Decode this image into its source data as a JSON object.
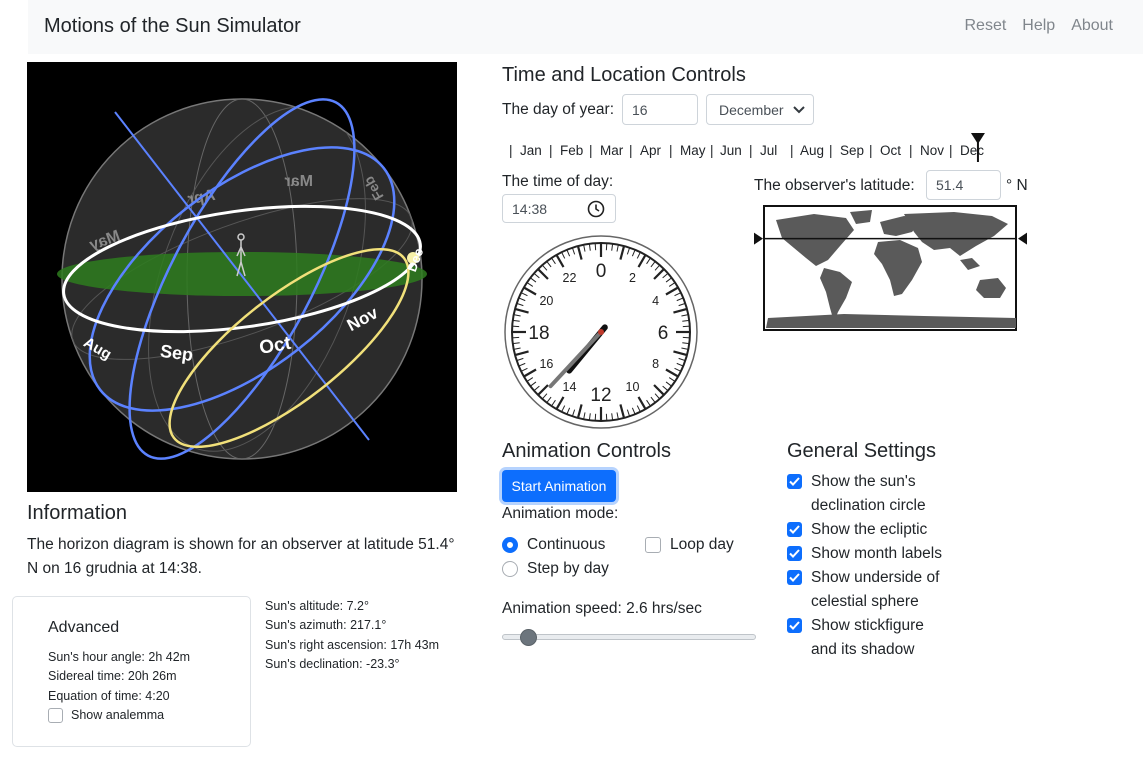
{
  "navbar": {
    "brand": "Motions of the Sun Simulator",
    "links": [
      "Reset",
      "Help",
      "About"
    ]
  },
  "sky": {
    "month_labels_front": [
      "Aug",
      "Sep",
      "Oct",
      "Nov",
      "Dec"
    ],
    "month_labels_back": [
      "May",
      "Apr",
      "Mar",
      "Feb"
    ],
    "colors": {
      "ecliptic": "#5b82ff",
      "horizon": "#2e7d1f",
      "declination": "#f1e07a",
      "celestial": "#ffffff"
    }
  },
  "information": {
    "heading": "Information",
    "text": "The horizon diagram is shown for an observer at latitude 51.4° N on 16 grudnia at 14:38."
  },
  "advanced": {
    "title": "Advanced",
    "hour_angle": "Sun's hour angle: 2h 42m",
    "sidereal": "Sidereal time: 20h 26m",
    "eq_time": "Equation of time: 4:20",
    "analemma_label": "Show analemma",
    "analemma_checked": false
  },
  "readouts": {
    "altitude": "Sun's altitude: 7.2°",
    "azimuth": "Sun's azimuth: 217.1°",
    "ra": "Sun's right ascension: 17h 43m",
    "dec": "Sun's declination: -23.3°"
  },
  "time_location": {
    "heading": "Time and Location Controls",
    "day_label": "The day of year:",
    "day_value": "16",
    "month_value": "December",
    "months": [
      "Jan",
      "Feb",
      "Mar",
      "Apr",
      "May",
      "Jun",
      "Jul",
      "Aug",
      "Sep",
      "Oct",
      "Nov",
      "Dec"
    ],
    "time_label": "The time of day:",
    "time_value": "14:38",
    "lat_label": "The observer's latitude:",
    "lat_value": "51.4",
    "lat_unit": "° N",
    "day_of_year_fraction": 0.955,
    "latitude_deg": 51.4
  },
  "clock": {
    "numbers": [
      "0",
      "2",
      "4",
      "6",
      "8",
      "10",
      "12",
      "14",
      "16",
      "18",
      "20",
      "22"
    ],
    "hour": 14,
    "minute": 38
  },
  "animation": {
    "heading": "Animation Controls",
    "start_label": "Start Animation",
    "mode_label": "Animation mode:",
    "continuous": "Continuous",
    "loop_day": "Loop day",
    "step_by_day": "Step by day",
    "selected_mode": "Continuous",
    "speed_label": "Animation speed: 2.6 hrs/sec",
    "speed_value": 2.6
  },
  "general": {
    "heading": "General Settings",
    "decl_line1": "Show the sun's",
    "decl_line2": "declination circle",
    "ecliptic": "Show the ecliptic",
    "month_labels": "Show month labels",
    "under_line1": "Show underside of",
    "under_line2": "celestial sphere",
    "stick_line1": "Show stickfigure",
    "stick_line2": "and its shadow",
    "all_checked": true
  }
}
